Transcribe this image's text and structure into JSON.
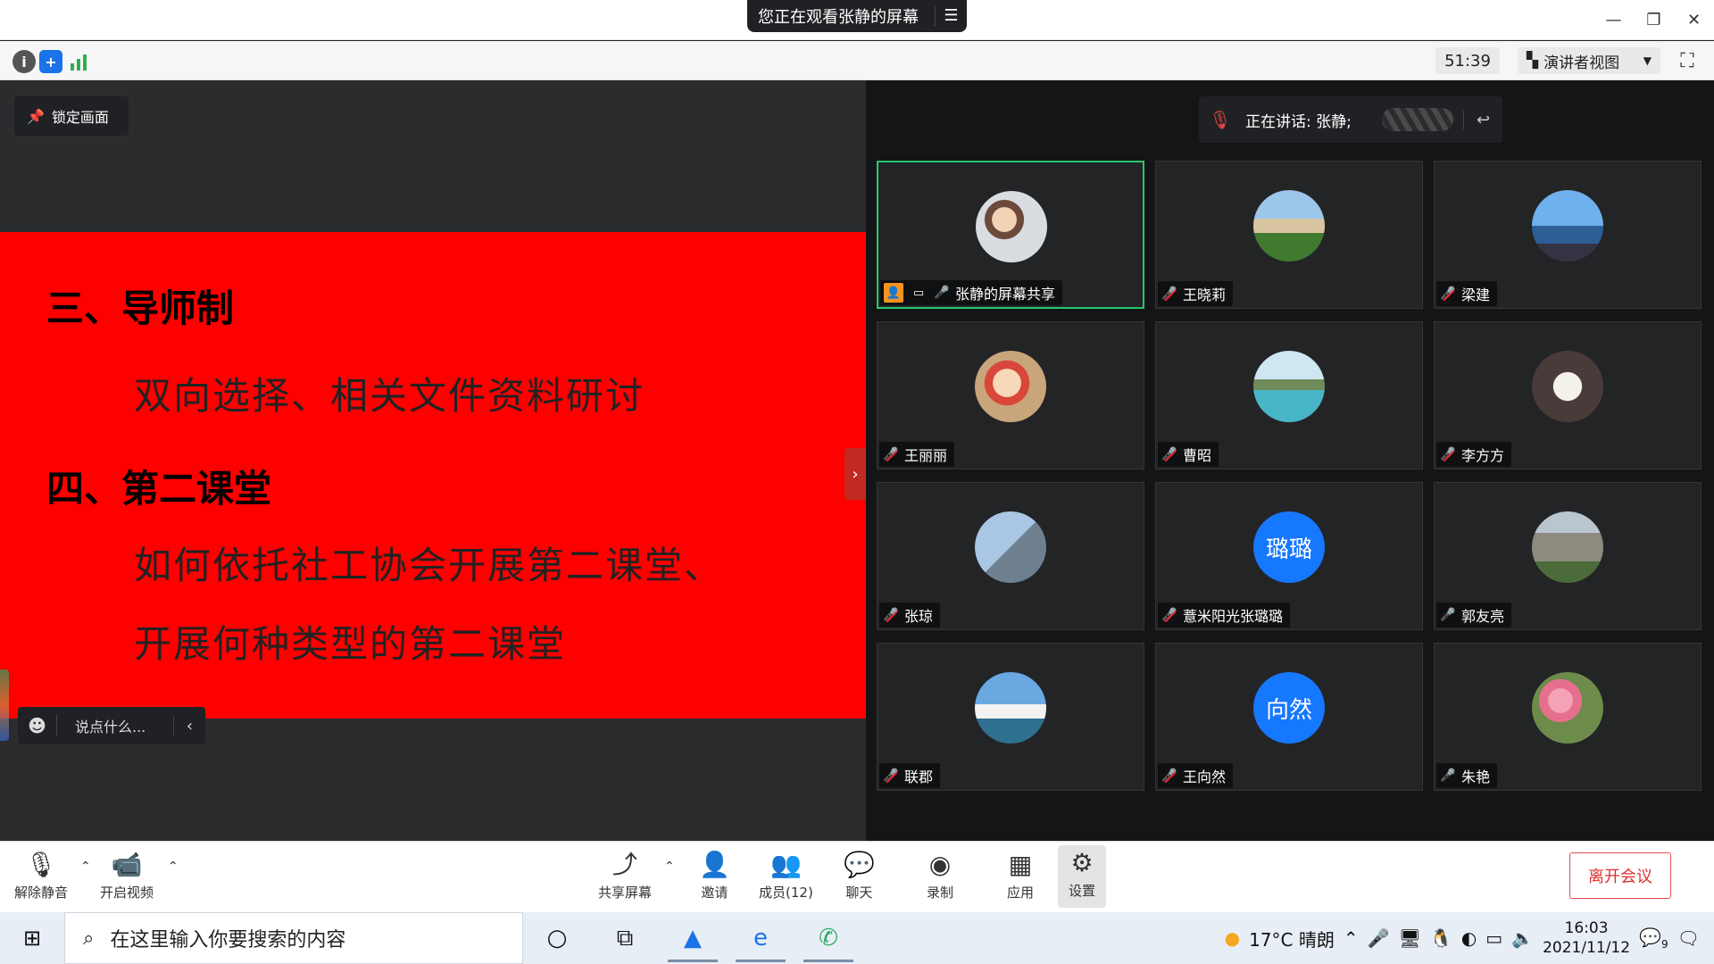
{
  "titlebar": {
    "share_notice": "您正在观看张静的屏幕",
    "menu_icon": "menu-icon",
    "minimize": "—",
    "restore": "❐",
    "close": "✕"
  },
  "infobar": {
    "timer": "51:39",
    "view_mode": "演讲者视图"
  },
  "stage": {
    "lock_label": "锁定画面",
    "slide": {
      "heading1": "三、导师制",
      "line1": "双向选择、相关文件资料研讨",
      "heading2": "四、第二课堂",
      "line2": "如何依托社工协会开展第二课堂、",
      "line3": "开展何种类型的第二课堂"
    },
    "chat_placeholder": "说点什么..."
  },
  "gallery": {
    "speaking_label": "正在讲话: 张静;",
    "tiles": [
      {
        "name": "张静的屏幕共享",
        "mic": "on",
        "avatar": "photo-child"
      },
      {
        "name": "王晓莉",
        "mic": "off",
        "avatar": "photo-castle"
      },
      {
        "name": "梁建",
        "mic": "off",
        "avatar": "photo-lighthouse"
      },
      {
        "name": "王丽丽",
        "mic": "off",
        "avatar": "photo-cartoon"
      },
      {
        "name": "曹昭",
        "mic": "off",
        "avatar": "photo-beach"
      },
      {
        "name": "李方方",
        "mic": "off",
        "avatar": "photo-lotus"
      },
      {
        "name": "张琼",
        "mic": "off",
        "avatar": "photo-tree"
      },
      {
        "name": "薏米阳光张璐璐",
        "mic": "off",
        "avatar_text": "璐璐"
      },
      {
        "name": "郭友亮",
        "mic": "on",
        "avatar": "photo-building"
      },
      {
        "name": "联郡",
        "mic": "off",
        "avatar": "photo-ship"
      },
      {
        "name": "王向然",
        "mic": "off",
        "avatar_text": "向然"
      },
      {
        "name": "朱艳",
        "mic": "on",
        "avatar": "photo-flowers"
      }
    ]
  },
  "controls": {
    "unmute": "解除静音",
    "start_video": "开启视频",
    "share_screen": "共享屏幕",
    "invite": "邀请",
    "members": "成员(12)",
    "chat": "聊天",
    "record": "录制",
    "apps": "应用",
    "settings": "设置",
    "leave": "离开会议"
  },
  "taskbar": {
    "search_placeholder": "在这里输入你要搜索的内容",
    "weather": "17°C  晴朗",
    "time": "16:03",
    "date": "2021/11/12",
    "notif_count": "9"
  },
  "colors": {
    "slide_bg": "#ff0000",
    "active_border": "#28c76f",
    "text_avatar_bg": "#1677ff",
    "leave_red": "#e03030"
  }
}
